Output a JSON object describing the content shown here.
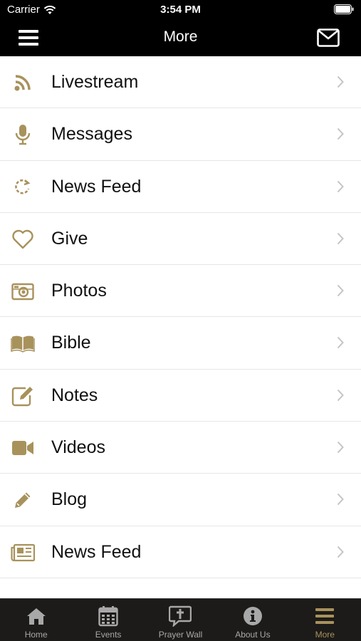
{
  "status_bar": {
    "carrier": "Carrier",
    "time": "3:54 PM"
  },
  "nav": {
    "title": "More"
  },
  "colors": {
    "accent": "#a8925c",
    "tabbar_bg": "#1c1b19",
    "inactive": "#a8a8a8"
  },
  "menu": {
    "items": [
      {
        "label": "Livestream",
        "icon": "rss-icon"
      },
      {
        "label": "Messages",
        "icon": "microphone-icon"
      },
      {
        "label": "News Feed",
        "icon": "refresh-icon"
      },
      {
        "label": "Give",
        "icon": "heart-icon"
      },
      {
        "label": "Photos",
        "icon": "camera-icon"
      },
      {
        "label": "Bible",
        "icon": "book-icon"
      },
      {
        "label": "Notes",
        "icon": "edit-icon"
      },
      {
        "label": "Videos",
        "icon": "video-camera-icon"
      },
      {
        "label": "Blog",
        "icon": "pencil-icon"
      },
      {
        "label": "News Feed",
        "icon": "newspaper-icon"
      }
    ]
  },
  "tabbar": {
    "tabs": [
      {
        "label": "Home",
        "icon": "home-icon"
      },
      {
        "label": "Events",
        "icon": "calendar-icon"
      },
      {
        "label": "Prayer Wall",
        "icon": "prayer-icon"
      },
      {
        "label": "About Us",
        "icon": "info-icon"
      },
      {
        "label": "More",
        "icon": "menu-icon",
        "active": true
      }
    ]
  }
}
